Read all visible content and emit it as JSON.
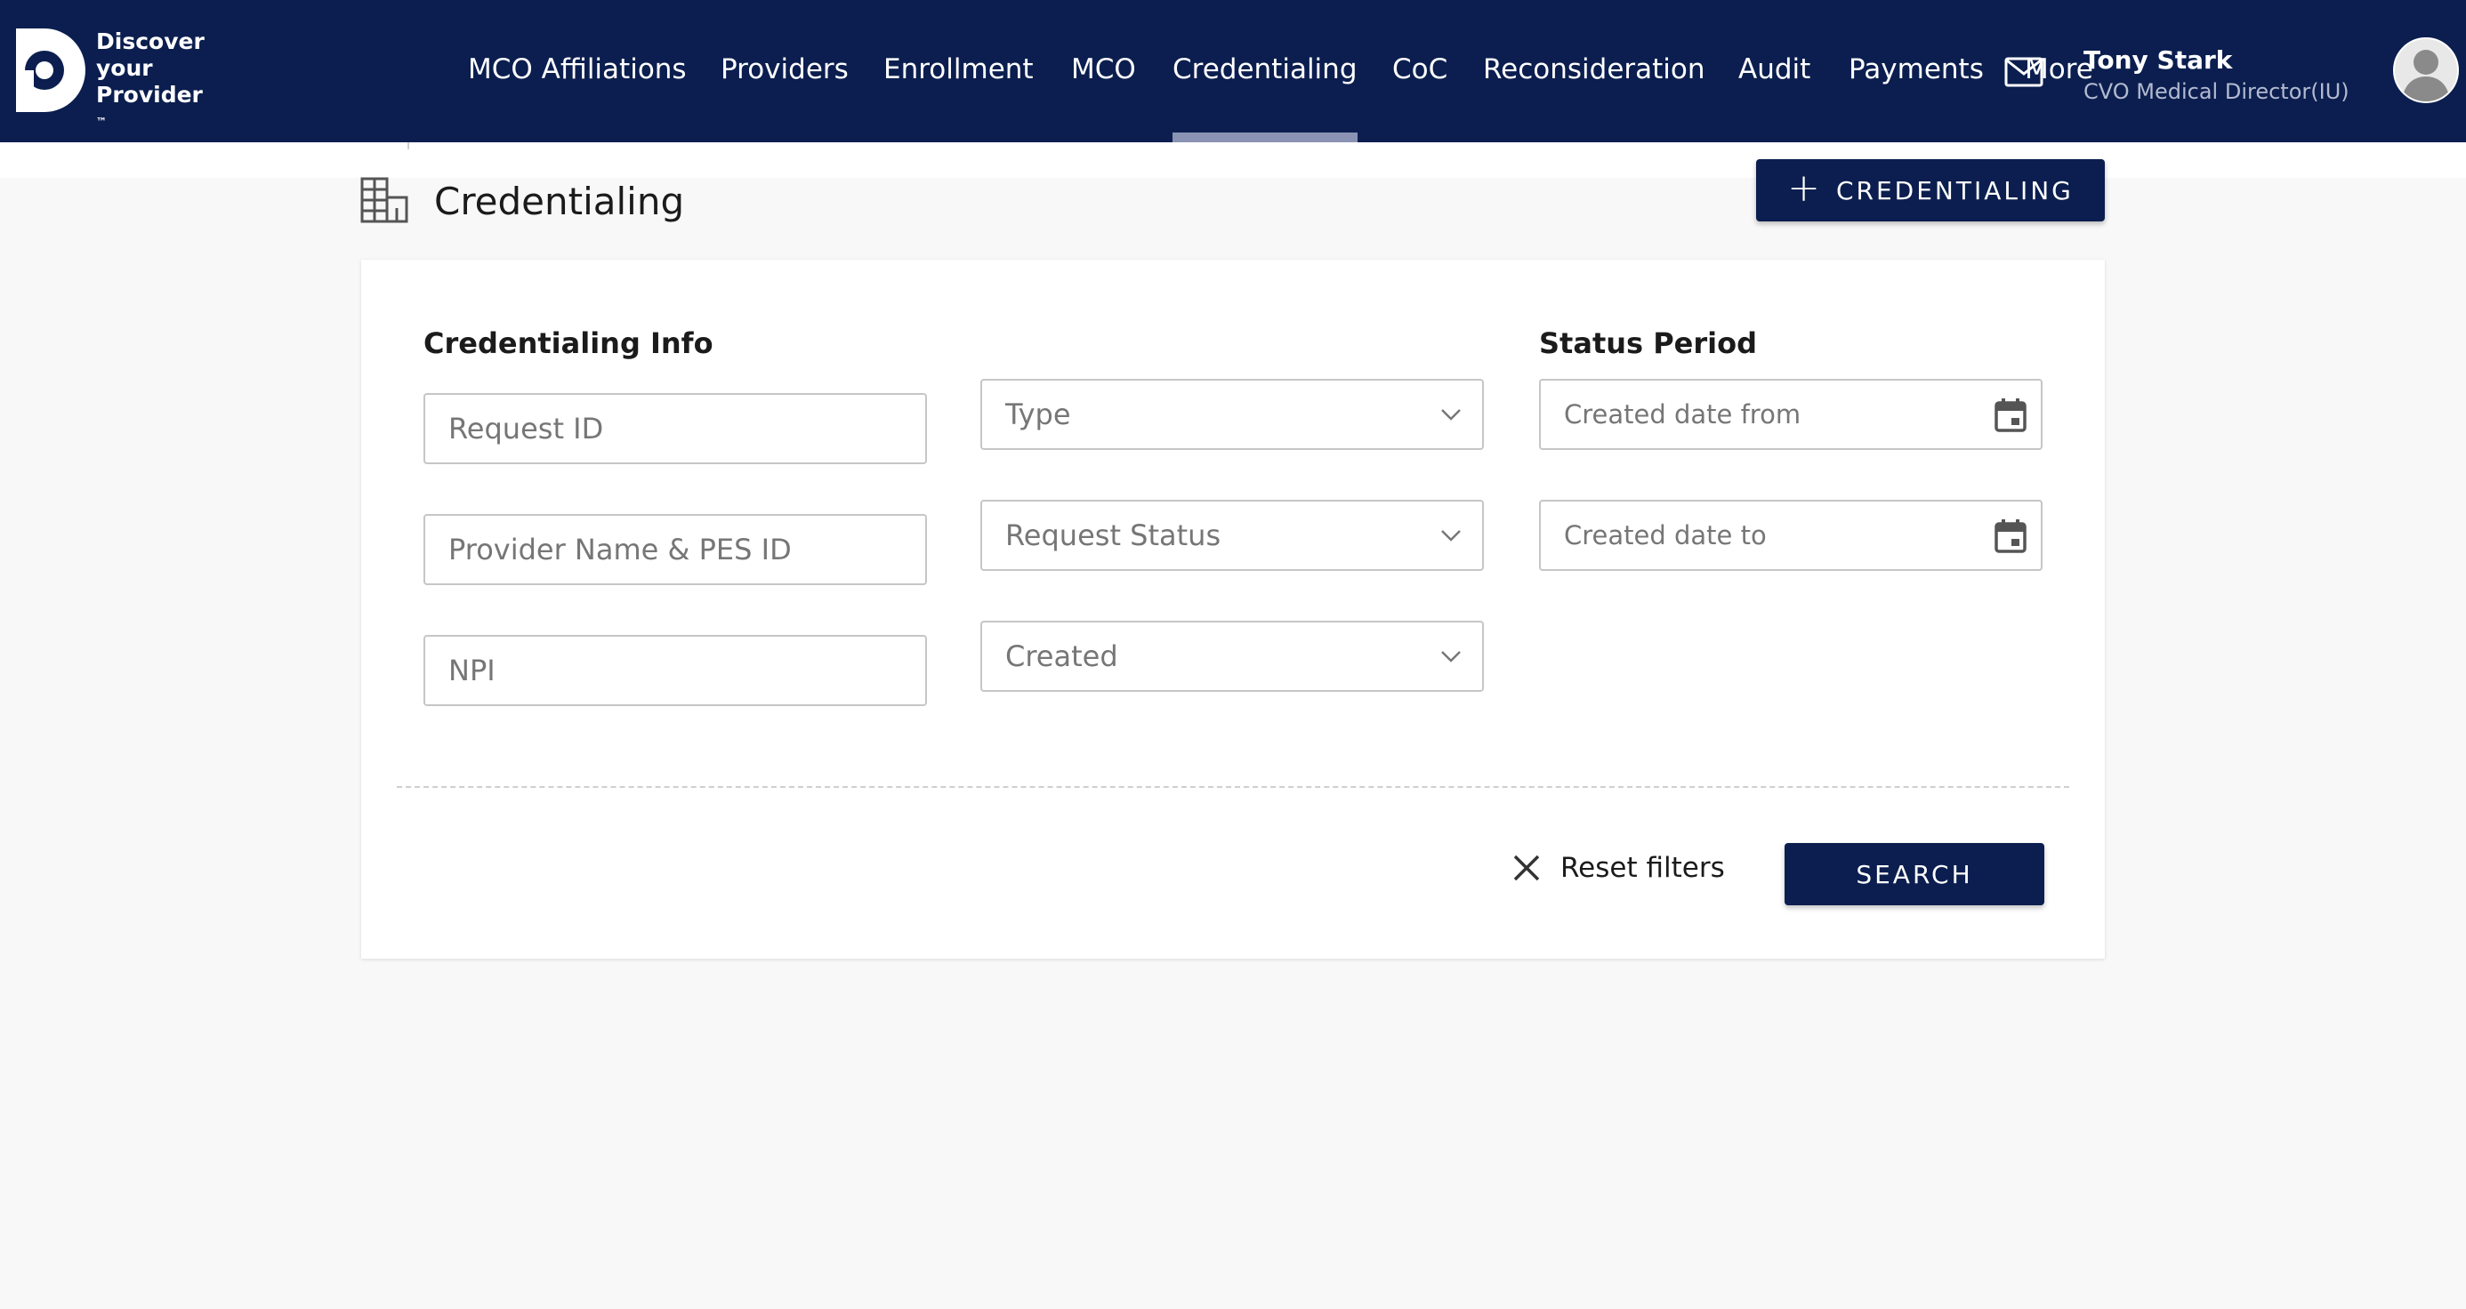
{
  "brand": {
    "line1": "Discover",
    "line2": "your",
    "line3": "Provider",
    "trademark": "™"
  },
  "nav": {
    "items": [
      "MCO Affiliations",
      "Providers",
      "Enrollment",
      "MCO",
      "Credentialing",
      "CoC",
      "Reconsideration",
      "Audit",
      "Payments",
      "More"
    ],
    "active": "Credentialing"
  },
  "user": {
    "name": "Tony Stark",
    "role": "CVO Medical Director(IU)"
  },
  "page": {
    "title": "Credentialing",
    "add_button_label": "CREDENTIALING"
  },
  "filters": {
    "credentialing_info_label": "Credentialing Info",
    "status_period_label": "Status Period",
    "request_id_placeholder": "Request ID",
    "provider_name_placeholder": "Provider Name & PES ID",
    "npi_placeholder": "NPI",
    "type_placeholder": "Type",
    "request_status_placeholder": "Request Status",
    "created_placeholder": "Created",
    "date_from_placeholder": "Created date from",
    "date_to_placeholder": "Created date to"
  },
  "actions": {
    "reset_label": "Reset filters",
    "search_label": "SEARCH"
  },
  "colors": {
    "primary": "#0b1e4f",
    "background": "#f8f8f8",
    "border": "#c6c6c6"
  }
}
